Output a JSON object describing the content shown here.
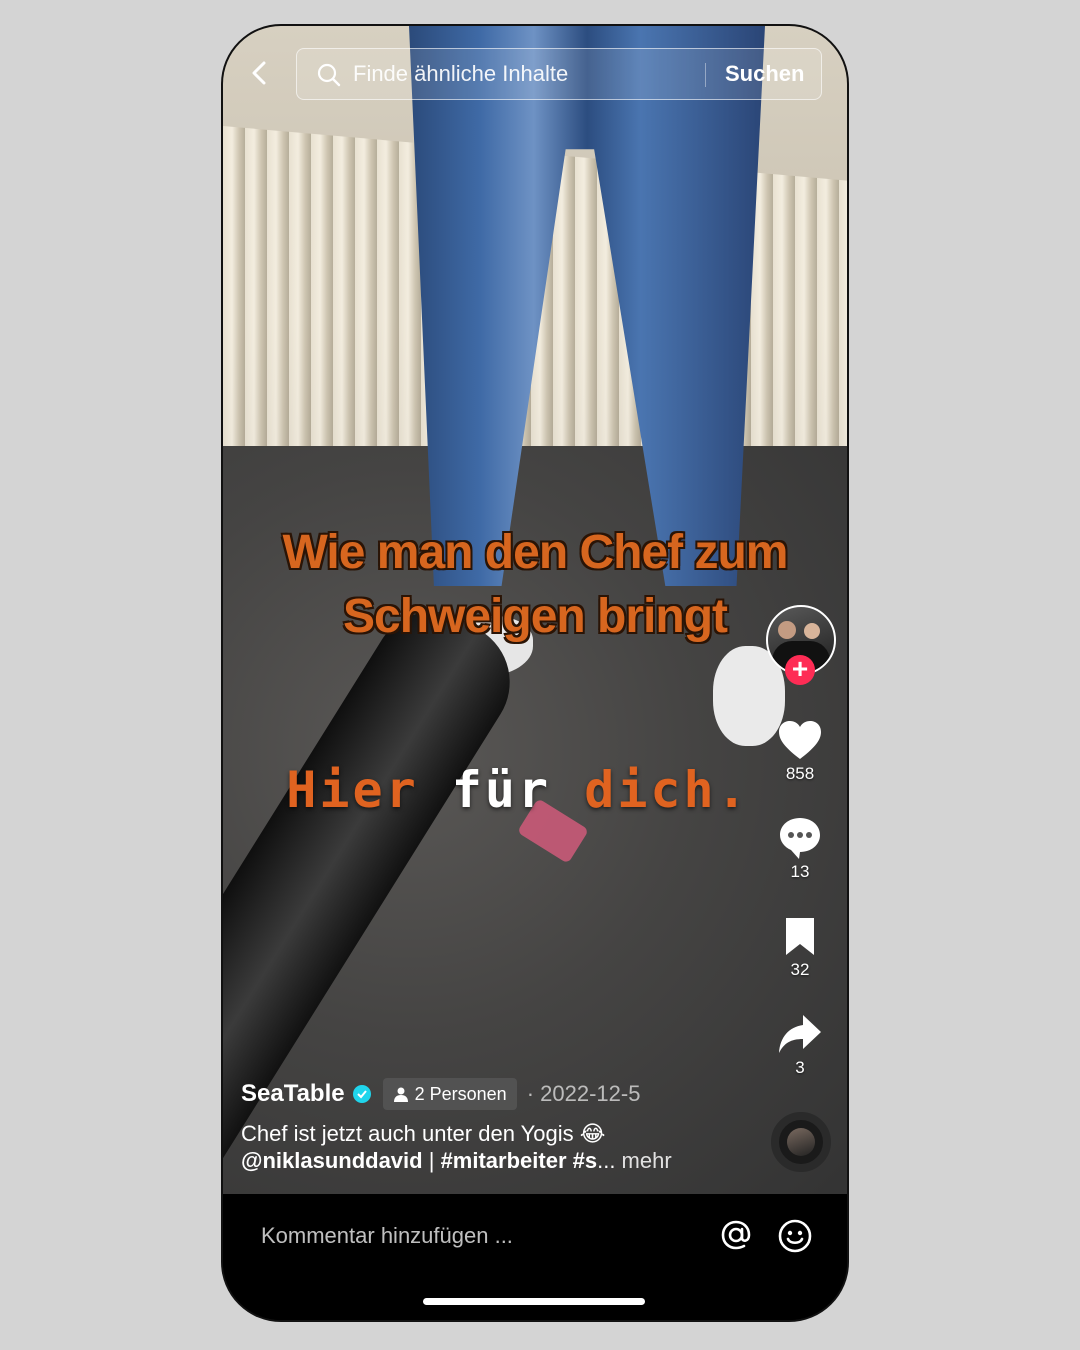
{
  "search": {
    "placeholder": "Finde ähnliche Inhalte",
    "button": "Suchen"
  },
  "video": {
    "caption_top_line1": "Wie man den Chef zum",
    "caption_top_line2": "Schweigen bringt",
    "caption_bottom_word1": "Hier",
    "caption_bottom_word2": "für",
    "caption_bottom_word3": "dich."
  },
  "actions": {
    "likes": "858",
    "comments": "13",
    "saves": "32",
    "shares": "3"
  },
  "post": {
    "author": "SeaTable",
    "people_tag": "2 Personen",
    "date": "2022-12-5",
    "date_separator": "·",
    "description": "Chef ist jetzt auch unter den Yogis 😂",
    "mention": "@niklasunddavid",
    "tags_separator": " | ",
    "hashtags": "#mitarbeiter #s",
    "ellipsis": "...",
    "more": " mehr"
  },
  "comment_bar": {
    "placeholder": "Kommentar hinzufügen ..."
  },
  "colors": {
    "accent": "#fe2c55",
    "verified": "#20d5ec",
    "caption_orange": "#d7661f"
  },
  "icons": [
    "back-icon",
    "search-icon",
    "plus-icon",
    "heart-icon",
    "comment-icon",
    "bookmark-icon",
    "share-icon",
    "verified-icon",
    "person-icon",
    "at-icon",
    "emoji-icon"
  ]
}
